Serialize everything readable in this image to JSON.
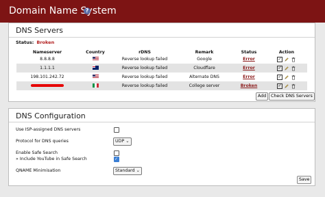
{
  "header": {
    "title": "Domain Name System",
    "help_icon": "?"
  },
  "dns_servers": {
    "title": "DNS Servers",
    "status_label": "Status:",
    "status_value": "Broken",
    "columns": [
      "Nameserver",
      "Country",
      "rDNS",
      "Remark",
      "Status",
      "Action"
    ],
    "rows": [
      {
        "nameserver": "8.8.8.8",
        "country": "us-flag",
        "rdns": "Reverse lookup failed",
        "remark": "Google",
        "status": "Error"
      },
      {
        "nameserver": "1.1.1.1",
        "country": "au-flag",
        "rdns": "Reverse lookup failed",
        "remark": "Cloudflare",
        "status": "Error"
      },
      {
        "nameserver": "198.101.242.72",
        "country": "us-flag",
        "rdns": "Reverse lookup failed",
        "remark": "Alternate DNS",
        "status": "Error"
      },
      {
        "nameserver": "",
        "country": "it-flag",
        "rdns": "Reverse lookup failed",
        "remark": "College server",
        "status": "Broken"
      }
    ],
    "add_label": "Add",
    "check_label": "Check DNS Servers"
  },
  "dns_config": {
    "title": "DNS Configuration",
    "isp_label": "Use ISP-assigned DNS servers",
    "isp_checked": false,
    "protocol_label": "Protocol for DNS queries",
    "protocol_value": "UDP",
    "safe_search_label": "Enable Safe Search",
    "safe_search_checked": false,
    "youtube_label": "» Include YouTube in Safe Search",
    "youtube_checked": true,
    "qname_label": "QNAME Minimisation",
    "qname_value": "Standard",
    "save_label": "Save"
  }
}
